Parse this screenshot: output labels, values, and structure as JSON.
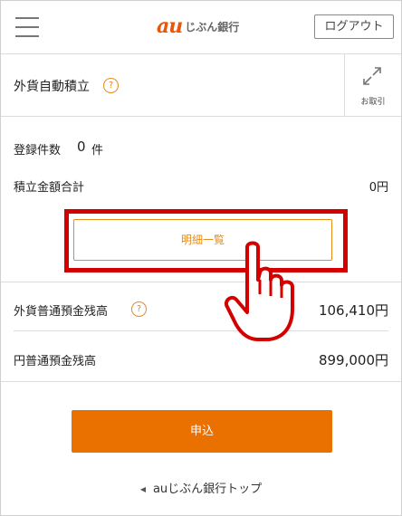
{
  "header": {
    "logo_mark": "au",
    "logo_text": "じぶん銀行",
    "logout_label": "ログアウト"
  },
  "section": {
    "title": "外貨自動積立",
    "help_glyph": "?",
    "trade_label": "お取引"
  },
  "summary": {
    "count_label": "登録件数",
    "count_value": "0",
    "count_unit": "件",
    "total_label": "積立金額合計",
    "total_value": "0円",
    "detail_button_label": "明細一覧"
  },
  "balances": {
    "fx_label": "外貨普通預金残高",
    "fx_value": "106,410円",
    "yen_label": "円普通預金残高",
    "yen_value": "899,000円"
  },
  "actions": {
    "apply_label": "申込",
    "back_arrow": "◀",
    "back_label": "auじぶん銀行トップ"
  },
  "colors": {
    "accent": "#ea7000",
    "highlight": "#d40000",
    "brand": "#eb5505"
  },
  "icons": {
    "menu": "hamburger-menu-icon",
    "help": "question-circle-icon",
    "trade": "exchange-arrows-icon",
    "pointer": "pointing-hand-icon"
  }
}
